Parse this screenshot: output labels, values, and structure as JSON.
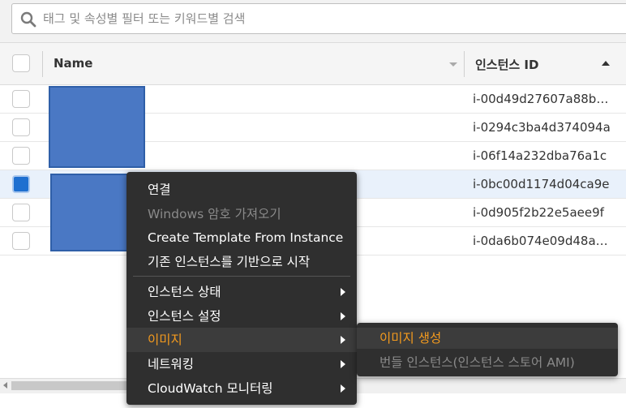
{
  "search": {
    "placeholder": "태그 및 속성별 필터 또는 키워드별 검색"
  },
  "table": {
    "columns": {
      "name": "Name",
      "instance_id": "인스턴스 ID"
    },
    "rows": [
      {
        "instance_id": "i-00d49d27607a88b…",
        "selected": false
      },
      {
        "instance_id": "i-0294c3ba4d374094a",
        "selected": false
      },
      {
        "instance_id": "i-06f14a232dba76a1c",
        "selected": false
      },
      {
        "instance_id": "i-0bc00d1174d04ca9e",
        "selected": true
      },
      {
        "instance_id": "i-0d905f2b22e5aee9f",
        "selected": false
      },
      {
        "instance_id": "i-0da6b074e09d48a…",
        "selected": false
      }
    ]
  },
  "context_menu": {
    "items": [
      {
        "label": "연결",
        "disabled": false
      },
      {
        "label": "Windows 암호 가져오기",
        "disabled": true
      },
      {
        "label": "Create Template From Instance",
        "disabled": false
      },
      {
        "label": "기존 인스턴스를 기반으로 시작",
        "disabled": false
      }
    ],
    "submenus": [
      {
        "label": "인스턴스 상태",
        "active": false
      },
      {
        "label": "인스턴스 설정",
        "active": false
      },
      {
        "label": "이미지",
        "active": true
      },
      {
        "label": "네트워킹",
        "active": false
      },
      {
        "label": "CloudWatch 모니터링",
        "active": false
      }
    ]
  },
  "image_submenu": {
    "items": [
      {
        "label": "이미지 생성",
        "disabled": false
      },
      {
        "label": "번들 인스턴스(인스턴스 스토어 AMI)",
        "disabled": true
      }
    ]
  },
  "colors": {
    "accent_orange": "#f39a1e",
    "menu_bg": "#2f2f2f",
    "checkbox_selected": "#1e6fd0",
    "redaction": "#4a78c4"
  }
}
